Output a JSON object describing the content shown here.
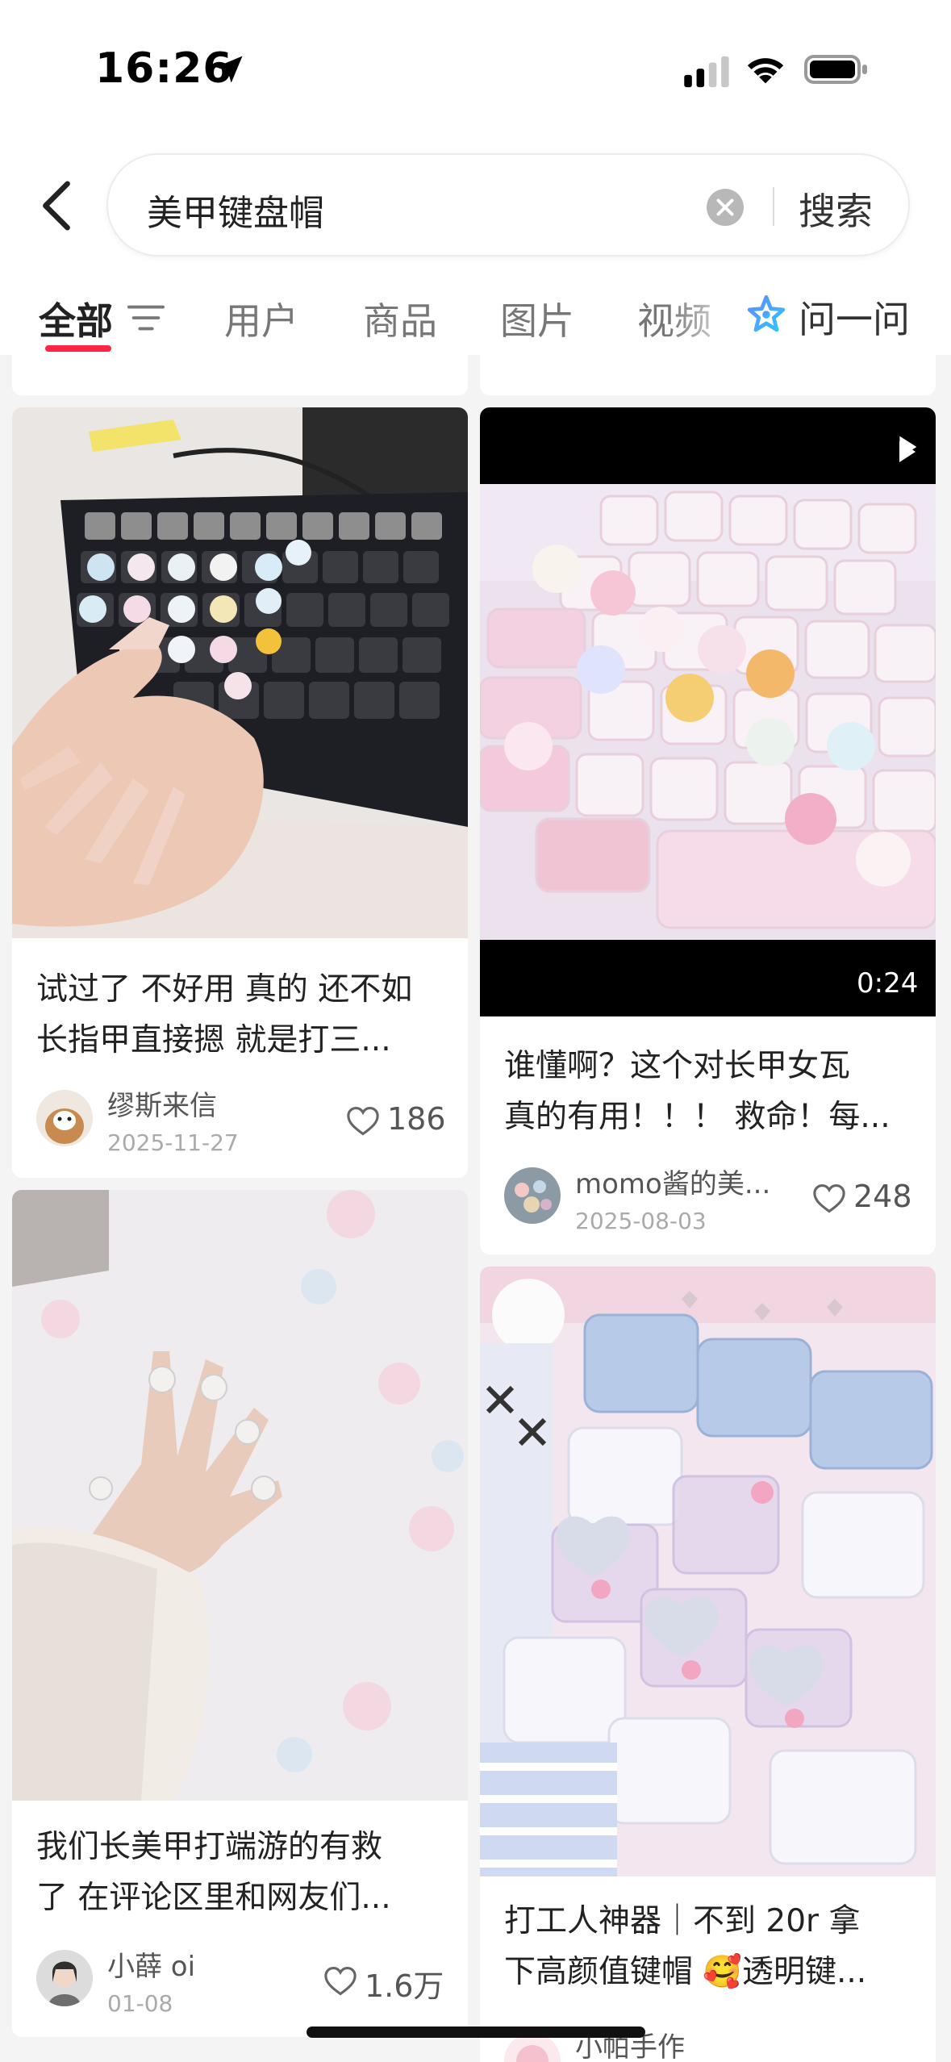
{
  "status_bar": {
    "time": "16:26",
    "icons": [
      "location-arrow-icon",
      "cellular-signal-icon",
      "wifi-icon",
      "battery-icon"
    ]
  },
  "search": {
    "query": "美甲键盘帽",
    "submit_label": "搜索",
    "icons": [
      "back-arrow-icon",
      "clear-icon"
    ]
  },
  "tabs": {
    "items": [
      "全部",
      "用户",
      "商品",
      "图片",
      "视频"
    ],
    "active": "全部",
    "ask_label": "问一问",
    "icons": [
      "filter-icon",
      "ask-star-icon"
    ]
  },
  "posts": [
    {
      "title_lines": [
        "试过了 不好用 真的 还不如",
        "长指甲直接摁 就是打三..."
      ],
      "author": "缪斯来信",
      "date": "2025-11-27",
      "likes": "186",
      "is_video": false
    },
    {
      "title_lines": [
        "谁懂啊？这个对长甲女瓦",
        "真的有用！！！ 救命！每..."
      ],
      "author": "momo酱的美...",
      "date": "2025-08-03",
      "likes": "248",
      "is_video": true,
      "duration": "0:24"
    },
    {
      "title_lines": [
        "我们长美甲打端游的有救",
        "了 在评论区里和网友们..."
      ],
      "author": "小薛 oi",
      "date": "01-08",
      "likes": "1.6万",
      "is_video": false
    },
    {
      "title_lines": [
        "打工人神器｜不到 20r 拿",
        "下高颜值键帽 🥰透明键..."
      ],
      "author": "小帕手作",
      "is_video": false
    }
  ],
  "colors": {
    "accent": "#ff2442",
    "background": "#f4f4f4",
    "card": "#ffffff"
  }
}
